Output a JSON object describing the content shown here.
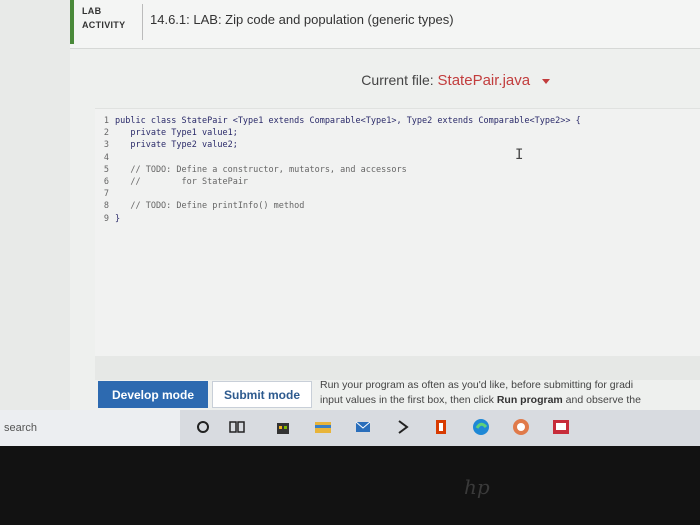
{
  "header": {
    "badge_line1": "LAB",
    "badge_line2": "ACTIVITY",
    "title": "14.6.1: LAB: Zip code and population (generic types)"
  },
  "file_selector": {
    "label": "Current file:",
    "filename": "StatePair.java"
  },
  "code_lines": [
    {
      "n": "1",
      "text": "public class StatePair <Type1 extends Comparable<Type1>, Type2 extends Comparable<Type2>> {"
    },
    {
      "n": "2",
      "text": "   private Type1 value1;"
    },
    {
      "n": "3",
      "text": "   private Type2 value2;"
    },
    {
      "n": "4",
      "text": ""
    },
    {
      "n": "5",
      "text": "   // TODO: Define a constructor, mutators, and accessors"
    },
    {
      "n": "6",
      "text": "   //        for StatePair"
    },
    {
      "n": "7",
      "text": ""
    },
    {
      "n": "8",
      "text": "   // TODO: Define printInfo() method"
    },
    {
      "n": "9",
      "text": "}"
    }
  ],
  "buttons": {
    "develop": "Develop mode",
    "submit": "Submit mode"
  },
  "run_hint": {
    "line1": "Run your program as often as you'd like, before submitting for gradi",
    "line2_pre": "input values in the first box, then click ",
    "line2_bold": "Run program",
    "line2_post": " and observe the"
  },
  "taskbar": {
    "search_text": "search",
    "icons": [
      "cortana-icon",
      "task-view-icon",
      "store-icon",
      "file-explorer-icon",
      "mail-icon",
      "dropbox-icon",
      "office-icon",
      "edge-icon",
      "skype-icon",
      "news-icon"
    ]
  },
  "colors": {
    "accent_red": "#c23d3d",
    "develop_blue": "#2d6ab0",
    "lab_green": "#4a8a3a"
  }
}
